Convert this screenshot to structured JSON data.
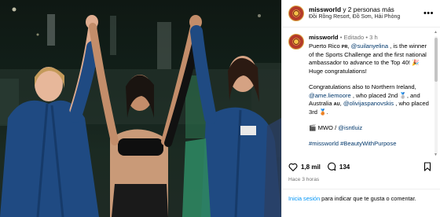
{
  "header": {
    "username": "missworld",
    "others": " y 2 personas más",
    "location": "Đồi Rồng Resort, Đồ Sơn, Hải Phòng",
    "more_icon": "ellipsis-icon"
  },
  "caption": {
    "username": "missworld",
    "edited": "Editado",
    "time": "3 h",
    "p1_a": "Puerto Rico ",
    "p1_flag": "PR",
    "p1_b": ", ",
    "p1_mention": "@suilanyelina",
    "p1_c": " , is the winner of the Sports Challenge and the first national ambassador to advance to the Top 40! ",
    "p1_emoji": "🎉",
    "p1_d": " Huge congratulations!",
    "p2_a": "Congratulations also to Northern Ireland, ",
    "p2_mention1": "@ame.liemoore",
    "p2_b": " , who placed 2nd ",
    "p2_medal1": "🥈",
    "p2_c": ", and Australia ",
    "p2_flag": "AU",
    "p2_d": ", ",
    "p2_mention2": "@olivijaspanovskis",
    "p2_e": " , who placed 3rd ",
    "p2_medal2": "🥉",
    "p2_f": ".",
    "p3_a": "🎬 MWO / ",
    "p3_mention": "@isntluiz",
    "hashtags": "#missworld #BeautyWithPurpose"
  },
  "actions": {
    "likes": "1,8 mil",
    "comments": "134",
    "like_icon": "heart-icon",
    "comment_icon": "comment-icon",
    "save_icon": "bookmark-icon"
  },
  "timestamp": "Hace 3 horas",
  "login": {
    "link": "Inicia sesión",
    "text": " para indicar que te gusta o comentar."
  },
  "colors": {
    "link": "#00376b",
    "login_link": "#0095f6",
    "meta": "#737373",
    "robe": "#1f4a82"
  }
}
